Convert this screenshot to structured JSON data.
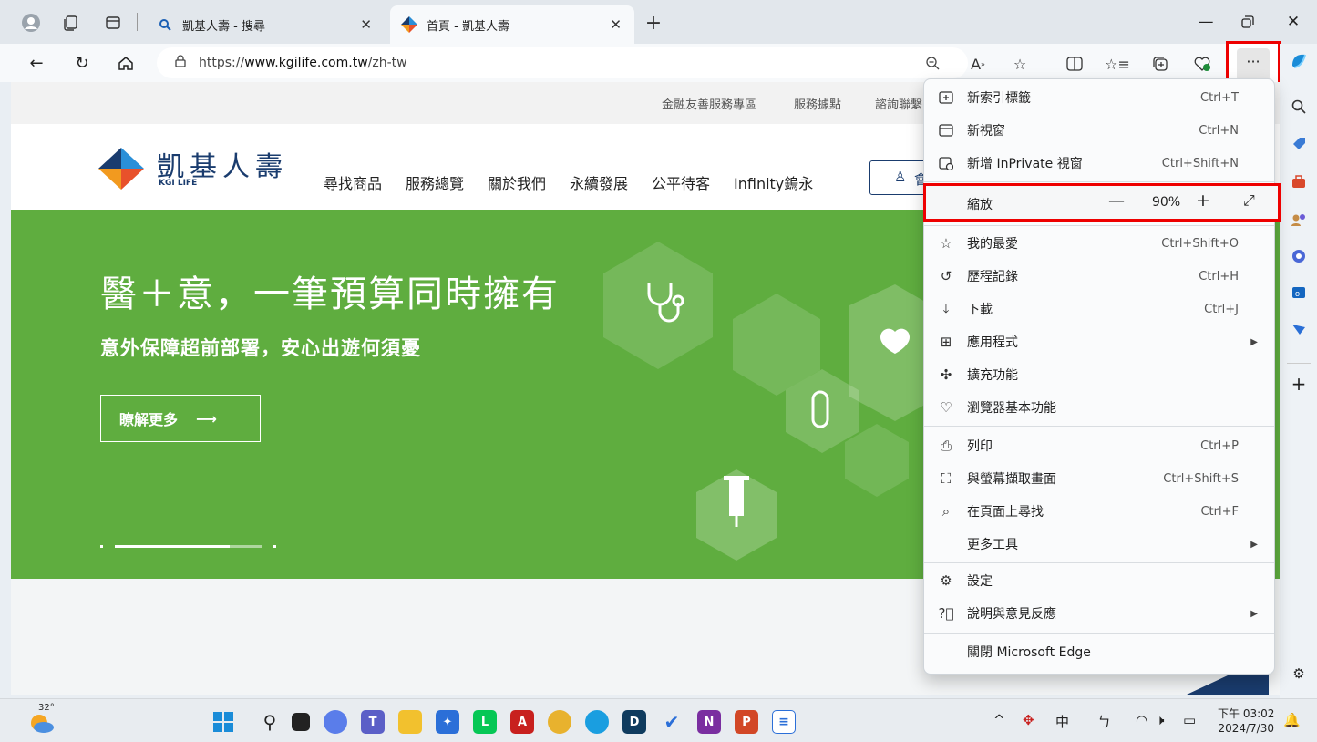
{
  "browser": {
    "tabs": [
      {
        "title": "凱基人壽 - 搜尋"
      },
      {
        "title": "首頁 - 凱基人壽"
      }
    ],
    "new_tab": "+",
    "url_prefix": "https://",
    "url_domain": "www.kgilife.com.tw",
    "url_path": "/zh-tw",
    "more_label": "···"
  },
  "site": {
    "top_links": [
      "金融友善服務專區",
      "服務據點",
      "諮詢聯繫"
    ],
    "logo_name": "凱基人壽",
    "logo_sub": "KGI LIFE",
    "nav": [
      "尋找商品",
      "服務總覽",
      "關於我們",
      "永續發展",
      "公平待客",
      "Infinity鎢永"
    ],
    "member_label": "會",
    "hero_title": "醫＋意，一筆預算同時擁有",
    "hero_subtitle": "意外保障超前部署，安心出遊何須憂",
    "hero_button": "瞭解更多",
    "hero_button_arrow": "⟶"
  },
  "menu": {
    "items": [
      {
        "label": "新索引標籤",
        "shortcut": "Ctrl+T",
        "icon": "new-tab-icon"
      },
      {
        "label": "新視窗",
        "shortcut": "Ctrl+N",
        "icon": "new-window-icon"
      },
      {
        "label": "新增 InPrivate 視窗",
        "shortcut": "Ctrl+Shift+N",
        "icon": "inprivate-icon"
      },
      {
        "label": "我的最愛",
        "shortcut": "Ctrl+Shift+O",
        "icon": "favorites-icon"
      },
      {
        "label": "歷程記錄",
        "shortcut": "Ctrl+H",
        "icon": "history-icon"
      },
      {
        "label": "下載",
        "shortcut": "Ctrl+J",
        "icon": "download-icon"
      },
      {
        "label": "應用程式",
        "shortcut": "",
        "icon": "apps-icon"
      },
      {
        "label": "擴充功能",
        "shortcut": "",
        "icon": "extensions-icon"
      },
      {
        "label": "瀏覽器基本功能",
        "shortcut": "",
        "icon": "browser-essentials-icon"
      },
      {
        "label": "列印",
        "shortcut": "Ctrl+P",
        "icon": "print-icon"
      },
      {
        "label": "與螢幕擷取畫面",
        "shortcut": "Ctrl+Shift+S",
        "icon": "screenshot-icon"
      },
      {
        "label": "在頁面上尋找",
        "shortcut": "Ctrl+F",
        "icon": "find-icon"
      },
      {
        "label": "更多工具",
        "shortcut": "",
        "icon": ""
      },
      {
        "label": "設定",
        "shortcut": "",
        "icon": "settings-icon"
      },
      {
        "label": "說明與意見反應",
        "shortcut": "",
        "icon": "help-icon"
      },
      {
        "label": "關閉 Microsoft Edge",
        "shortcut": "",
        "icon": ""
      }
    ],
    "zoom_label": "縮放",
    "zoom_value": "90%",
    "zoom_minus": "—",
    "zoom_plus": "+",
    "zoom_fullscreen": "⤢"
  },
  "taskbar": {
    "weather_temp": "32°",
    "time": "下午 03:02",
    "date": "2024/7/30",
    "ime_lang": "中",
    "ime_mode": "ㄅ"
  },
  "colors": {
    "hero_green": "#5fad3f",
    "brand_navy": "#1a3c6e",
    "highlight_red": "#ee0000"
  }
}
